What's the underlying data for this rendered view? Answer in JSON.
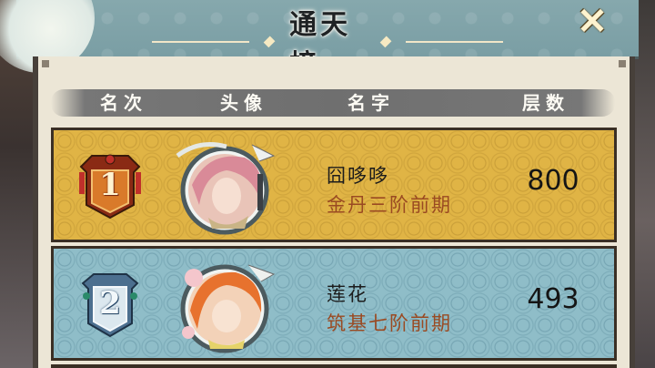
{
  "header": {
    "title": "通天榜",
    "close_symbol": "✕"
  },
  "columns": {
    "rank": "名次",
    "avatar": "头像",
    "name": "名字",
    "floors": "层数"
  },
  "entries": [
    {
      "rank": "1",
      "name": "囧哆哆",
      "realm": "金丹三阶前期",
      "floors": "800",
      "tier": "gold"
    },
    {
      "rank": "2",
      "name": "莲花",
      "realm": "筑基七阶前期",
      "floors": "493",
      "tier": "silver"
    }
  ],
  "colors": {
    "gold_row": "#e0b445",
    "blue_row": "#8fbdc8",
    "realm_text": "#9a4a22"
  },
  "icons": [
    "close-icon",
    "rank-1-badge-icon",
    "rank-2-badge-icon"
  ]
}
